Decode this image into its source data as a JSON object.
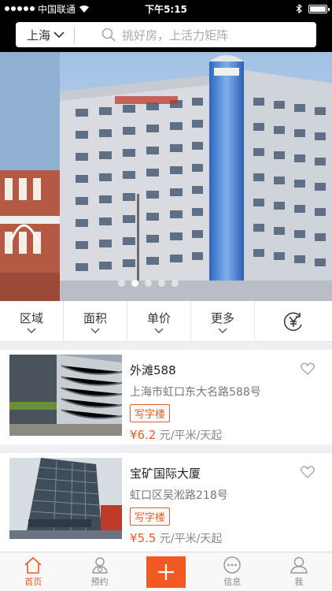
{
  "status_bar": {
    "carrier": "中国联通",
    "time": "下午5:15",
    "battery_level": 1.0
  },
  "header": {
    "city": "上海",
    "search_placeholder": "挑好房，上活力矩阵"
  },
  "banner": {
    "slide_count": 5,
    "active_index": 1
  },
  "filters": {
    "items": [
      {
        "label": "区域"
      },
      {
        "label": "面积"
      },
      {
        "label": "单价"
      },
      {
        "label": "更多"
      }
    ],
    "currency_icon": "yen-swap-icon"
  },
  "listings": [
    {
      "title": "外滩588",
      "address": "上海市虹口东大名路588号",
      "tag": "写字楼",
      "price": "¥6.2",
      "unit": "元/平米/天起"
    },
    {
      "title": "宝矿国际大厦",
      "address": "虹口区吴淞路218号",
      "tag": "写字楼",
      "price": "¥5.5",
      "unit": "元/平米/天起"
    }
  ],
  "tabbar": {
    "items": [
      {
        "label": "首页",
        "icon": "home-icon"
      },
      {
        "label": "预约",
        "icon": "appointment-icon"
      },
      {
        "label": "",
        "icon": "plus-icon"
      },
      {
        "label": "信息",
        "icon": "message-icon"
      },
      {
        "label": "我",
        "icon": "profile-icon"
      }
    ]
  },
  "colors": {
    "accent": "#f15a22",
    "header_bg": "#000000",
    "page_gap": "#efeff4"
  }
}
